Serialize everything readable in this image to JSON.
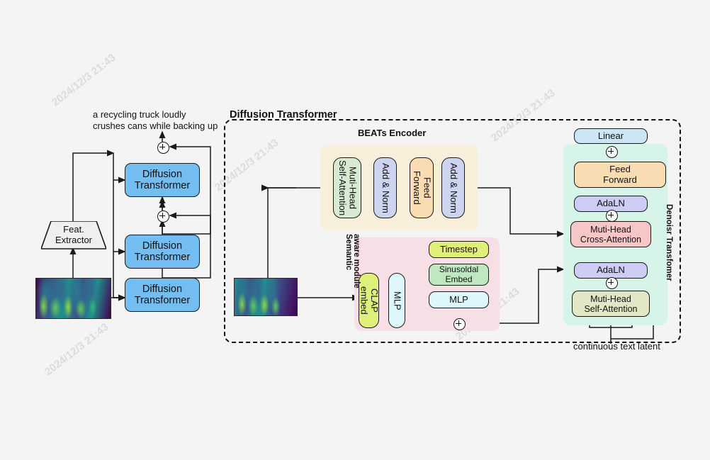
{
  "figure": {
    "prompt_caption": "a recycling truck loudly\ncrushes cans while backing up",
    "prompt_line1": "a recycling truck loudly",
    "prompt_line2": "crushes cans while backing up",
    "bottom_caption": "continuous text latent"
  },
  "titles": {
    "diffusion_transformer": "Diffusion Transformer",
    "beats_encoder": "BEATs Encoder",
    "semantic_module_line1": "Semantic",
    "semantic_module_line2": "aware module",
    "denoiser": "Denoisr  Transfomer"
  },
  "left_stack": {
    "feat_extractor_line1": "Feat.",
    "feat_extractor_line2": "Extractor",
    "blocks": [
      {
        "line1": "Diffusion",
        "line2": "Transformer"
      },
      {
        "line1": "Diffusion",
        "line2": "Transformer"
      },
      {
        "line1": "Diffusion",
        "line2": "Transformer"
      }
    ]
  },
  "beats": {
    "blocks": [
      {
        "line1": "Muti-Head",
        "line2": "Self-Attention",
        "color": "#d9ead3"
      },
      {
        "line1": "Add & Norm",
        "line2": "",
        "color": "#ccd4f0"
      },
      {
        "line1": "Feed",
        "line2": "Forward",
        "color": "#fadcb3"
      },
      {
        "line1": "Add & Norm",
        "line2": "",
        "color": "#ccd4f0"
      }
    ],
    "panel_color": "#f7efd9"
  },
  "semantic": {
    "clap": "CLAP embed",
    "mlp_vert": "MLP",
    "timestep": "Timestep",
    "sinusoidal_line1": "Sinusoldal",
    "sinusoidal_line2": "Embed",
    "mlp": "MLP",
    "panel_color": "#f7dfe6",
    "clap_color": "#dff07a",
    "mlp_vert_color": "#ddf7fb",
    "timestep_color": "#dff07a",
    "sinusoidal_color": "#bfe8c0",
    "mlp_color": "#ddf7fb"
  },
  "denoiser": {
    "linear": "Linear",
    "feed_forward_line1": "Feed",
    "feed_forward_line2": "Forward",
    "adaln_top": "AdaLN",
    "cross_attn_line1": "Muti-Head",
    "cross_attn_line2": "Cross-Attention",
    "adaln_bottom": "AdaLN",
    "self_attn_line1": "Muti-Head",
    "self_attn_line2": "Self-Attention",
    "panel_color": "#d6f5e8",
    "linear_color": "#cce5f5",
    "feed_forward_color": "#fadcb3",
    "adaln_color": "#ccccf5",
    "cross_attn_color": "#f7c7c7",
    "self_attn_color": "#e2e8c6"
  },
  "watermarks": [
    "2024/12/3 21:43",
    "2024/12/3 21:43",
    "2024/12/3 21:43",
    "2024/12/3 21:43",
    "2024/12/3 21:43"
  ]
}
